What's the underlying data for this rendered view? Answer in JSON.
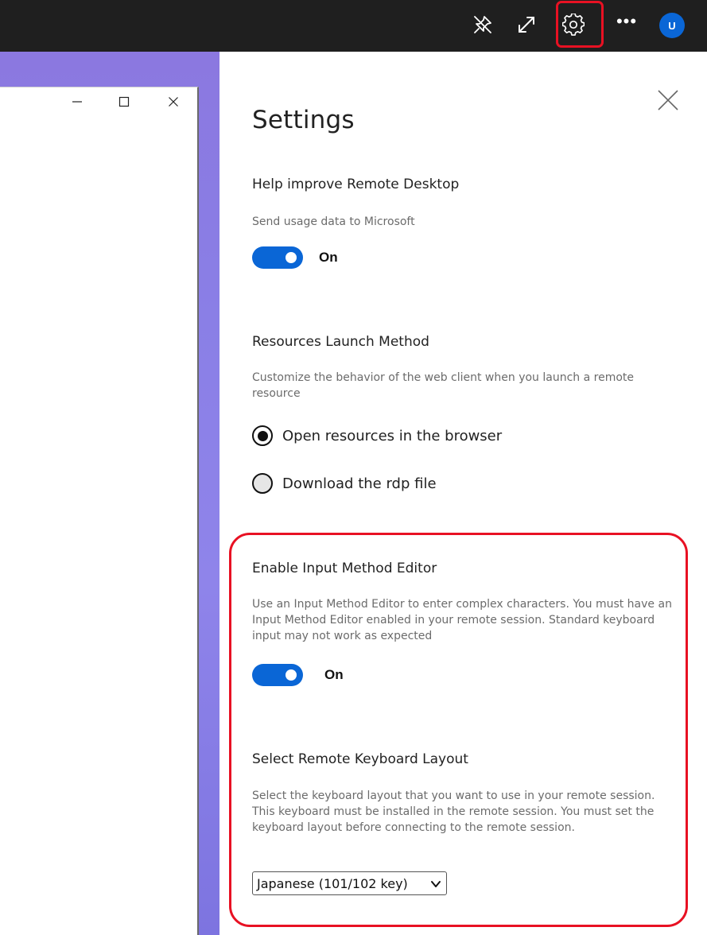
{
  "topbar": {
    "icons": [
      "pin-off-icon",
      "expand-icon",
      "gear-icon",
      "more-icon"
    ],
    "avatar_initial": "U",
    "highlight_color": "#e81123"
  },
  "background_window": {
    "controls": [
      "minimize-icon",
      "maximize-icon",
      "close-icon"
    ]
  },
  "settings": {
    "title": "Settings",
    "close_icon": "close-icon",
    "telemetry": {
      "title": "Help improve Remote Desktop",
      "description": "Send usage data to Microsoft",
      "toggle_state": "On",
      "toggle_on": true
    },
    "launch_method": {
      "title": "Resources Launch Method",
      "description": "Customize the behavior of the web client when you launch a remote resource",
      "options": [
        {
          "label": "Open resources in the browser",
          "selected": true
        },
        {
          "label": "Download the rdp file",
          "selected": false
        }
      ]
    },
    "ime": {
      "title": "Enable Input Method Editor",
      "description": "Use an Input Method Editor to enter complex characters. You must have an Input Method Editor enabled in your remote session. Standard keyboard input may not work as expected",
      "toggle_state": "On",
      "toggle_on": true
    },
    "keyboard_layout": {
      "title": "Select Remote Keyboard Layout",
      "description": "Select the keyboard layout that you want to use in your remote session. This keyboard must be installed in the remote session. You must set the keyboard layout before connecting to the remote session.",
      "selected_value": "Japanese (101/102 key)"
    }
  },
  "colors": {
    "accent": "#0a66d6",
    "topbar_bg": "#1f1f1f",
    "highlight": "#e81123",
    "desktop_bg": "#8b78e0"
  }
}
